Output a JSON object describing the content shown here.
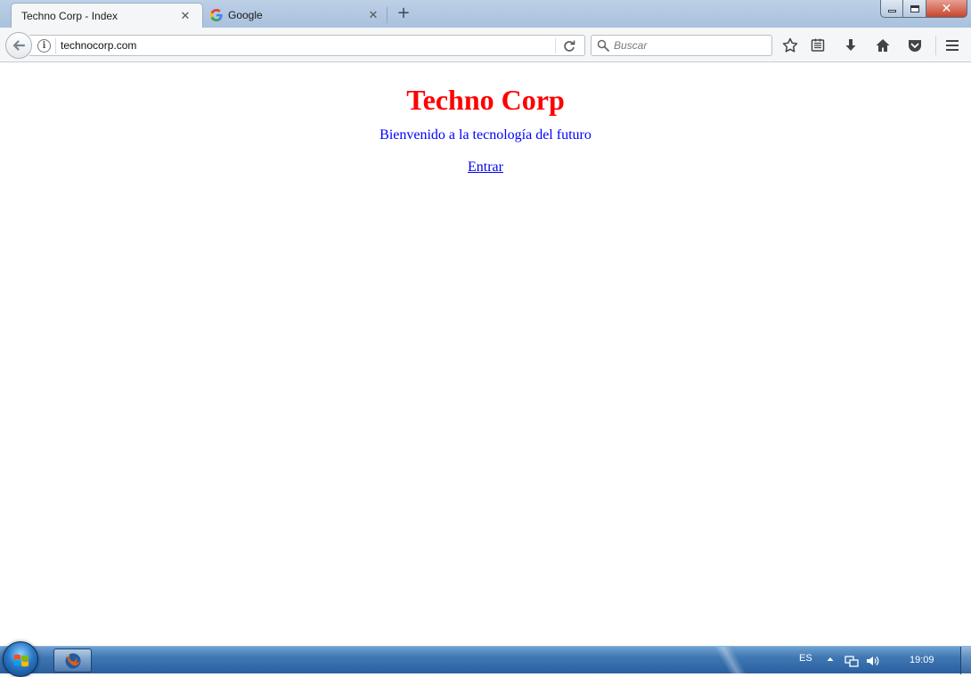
{
  "browser": {
    "tabs": [
      {
        "title": "Techno Corp - Index",
        "active": true
      },
      {
        "title": "Google",
        "active": false,
        "icon": "google-g-icon"
      }
    ],
    "window_controls": {
      "close_glyph": "✕"
    },
    "url": "technocorp.com",
    "search_placeholder": "Buscar",
    "toolbar_icons": [
      "star-icon",
      "reading-list-icon",
      "download-icon",
      "home-icon",
      "pocket-icon",
      "hamburger-menu-icon"
    ]
  },
  "page": {
    "title": "Techno Corp",
    "subtitle": "Bienvenido a la tecnología del futuro",
    "link_label": "Entrar",
    "colors": {
      "title": "#ff0000",
      "subtitle": "#0000ff",
      "link": "#0000ee"
    }
  },
  "taskbar": {
    "language": "ES",
    "clock": "19:09",
    "pinned_apps": [
      "firefox-icon"
    ]
  }
}
